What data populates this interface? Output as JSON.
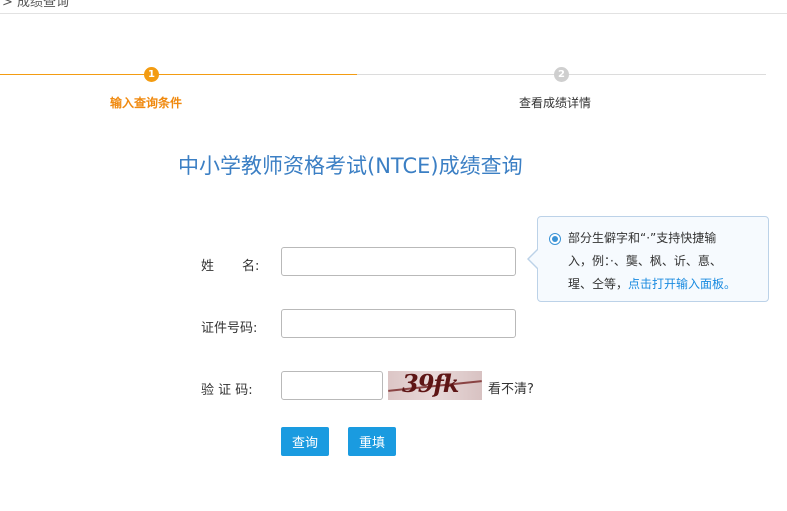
{
  "breadcrumb": "> 成绩查询",
  "steps": [
    {
      "number": "1",
      "label": "输入查询条件",
      "active": true
    },
    {
      "number": "2",
      "label": "查看成绩详情",
      "active": false
    }
  ],
  "title": "中小学教师资格考试(NTCE)成绩查询",
  "form": {
    "name_label_a": "姓",
    "name_label_b": "名:",
    "id_label": "证件号码:",
    "captcha_label": "验 证 码:",
    "name_value": "",
    "id_value": "",
    "captcha_value": "",
    "captcha_text": "39fk",
    "unclear_link": "看不清?"
  },
  "tip": {
    "text_line1": "部分生僻字和“·”支持快捷输",
    "text_line2": "入，例：·、龑、枫、䜣、惪、",
    "text_line3": "瑆、仝等，",
    "link": "点击打开输入面板。"
  },
  "buttons": {
    "query": "查询",
    "reset": "重填"
  },
  "colors": {
    "accent_orange": "#f39c12",
    "title_blue": "#3b7fc4",
    "button_blue": "#1a9be0",
    "link_blue": "#1a8be0"
  }
}
